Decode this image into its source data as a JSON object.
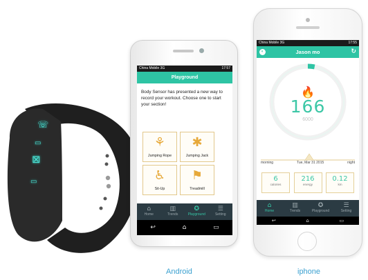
{
  "android": {
    "status": {
      "carrier": "China Mobile 3G",
      "time": "17:57"
    },
    "header_title": "Playground",
    "intro": "Body Sensor has presented a new way to record your workout. Choose one to start your section!",
    "tiles": [
      {
        "label": "Jumping Rope",
        "icon": "jump-rope-icon"
      },
      {
        "label": "Jumping Jack",
        "icon": "jumping-jack-icon"
      },
      {
        "label": "Sit-Up",
        "icon": "sit-up-icon"
      },
      {
        "label": "Treadmill",
        "icon": "treadmill-icon"
      }
    ],
    "nav": [
      {
        "label": "Home",
        "icon": "home-icon"
      },
      {
        "label": "Trends",
        "icon": "chart-icon"
      },
      {
        "label": "Playground",
        "icon": "star-icon",
        "active": true
      },
      {
        "label": "Setting",
        "icon": "list-icon"
      }
    ]
  },
  "iphone": {
    "status": {
      "carrier": "China Mobile 3G",
      "time": "17:55"
    },
    "header_title": "Jason mo",
    "ring": {
      "value": "166",
      "goal": "6000",
      "progress": 0.03
    },
    "timeline": {
      "start": "morning",
      "date": "Tue, Mar 31 2015",
      "end": "night"
    },
    "stats": [
      {
        "value": "6",
        "label": "calories"
      },
      {
        "value": "216",
        "label": "energy"
      },
      {
        "value": "0.12",
        "label": "km"
      }
    ],
    "nav": [
      {
        "label": "Home",
        "icon": "home-icon",
        "active": true
      },
      {
        "label": "Trends",
        "icon": "chart-icon"
      },
      {
        "label": "Playground",
        "icon": "star-icon"
      },
      {
        "label": "Setting",
        "icon": "list-icon"
      }
    ]
  },
  "captions": {
    "android": "Android",
    "iphone": "iphone"
  },
  "colors": {
    "accent": "#2ec4a4",
    "nav": "#2b3b43",
    "tile_border": "#e2c78a",
    "caption": "#3aa0d0"
  }
}
